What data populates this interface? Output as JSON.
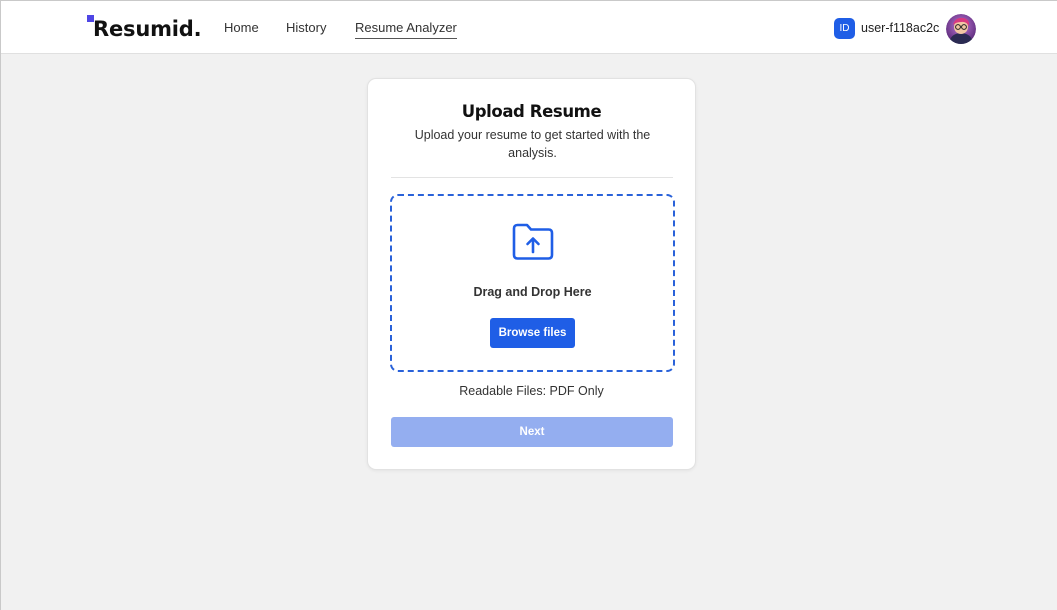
{
  "header": {
    "logo": "Resumid.",
    "nav": [
      {
        "label": "Home"
      },
      {
        "label": "History"
      },
      {
        "label": "Resume Analyzer",
        "active": true
      }
    ],
    "id_badge": "ID",
    "user_id": "user-f118ac2c",
    "avatar_icon": "user-avatar"
  },
  "card": {
    "title": "Upload Resume",
    "subtitle": "Upload your resume to get started with the analysis.",
    "dropzone": {
      "icon": "folder-upload-icon",
      "text": "Drag and Drop Here",
      "browse_label": "Browse files"
    },
    "readable_files": "Readable Files: PDF Only",
    "next_label": "Next",
    "next_disabled": true
  },
  "colors": {
    "accent": "#1f5ee6",
    "accent_disabled": "#94aef0",
    "logo_mark": "#4f46e5",
    "background": "#f1f1f1"
  }
}
